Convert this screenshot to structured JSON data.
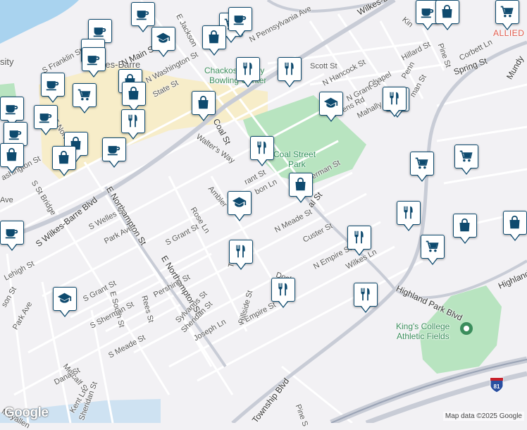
{
  "colors": {
    "background": "#f2f1f4",
    "road": "#ffffff",
    "major_road": "#c8ccd6",
    "river": "#a9d3ef",
    "park": "#b8e4c0",
    "downtown": "#f7edc9",
    "marker_border": "#0e4a6e",
    "marker_icon": "#0e4a6e"
  },
  "labels": {
    "wilkes_barre_city": "lkes-Barre",
    "university": "sity",
    "wilkes_st": "Wilkes-Ba",
    "allied": "ALLIED",
    "chackos": "Chackos Family",
    "bowling": "Bowling Center",
    "coal_street_park": "Coal Street",
    "coal_street_park_2": "Park",
    "kings_college": "King's College",
    "kings_college_2": "Athletic Fields",
    "n_main_st": "N Main St",
    "n_pennsylvania_ave": "N Pennsylvania Ave",
    "n_washington_st": "N Washington St",
    "s_franklin_st": "S Franklin St",
    "scott_st": "Scott St",
    "hillard_st": "Hillard St",
    "corbett_ln": "Corbett Ln",
    "spring_st": "Spring St",
    "mundy": "Mundy",
    "pine_st": "Pine St",
    "chapel": "Chapel",
    "n_hancock_st": "N Hancock St",
    "n_grant_st": "N Grant St",
    "mahally_st": "Mahally St",
    "stevens_rd": "Stevens Rd",
    "coal_st": "Coal St",
    "walters_way": "Walter's Way",
    "sherman_st": "erman St",
    "ambler": "Ambler",
    "grant_st": "rant St",
    "gibbon_ln": "bon Ln",
    "coal_st_2": "al St",
    "n_meade_st": "N Meade St",
    "custer_st": "Custer St",
    "n_empire_st": "N Empire St",
    "wilkes_ln": "Wilkes Ln",
    "dock": "Dock",
    "s_empire_st": "S Empire St",
    "highland_park_blvd": "Highland Park Blvd",
    "highland": "Highland",
    "s_wilkes_barre_blvd": "S Wilkes-Barre Blvd",
    "e_northampton_st": "E Northampton St",
    "e_northampton_st_2": "E Northampton St",
    "s_welles_st": "S Welles St",
    "park_ave": "Park Ave",
    "rose_ln": "Rose Ln",
    "s_grant_st": "S Grant St",
    "s_st_bridge": "S St Bridge",
    "ashington_st": "ashington St",
    "ave": "Ave",
    "lehigh_st": "Lehigh St",
    "son_st": "son St",
    "park_ave_2": "Park Ave",
    "s_grant_st_2": "S Grant St",
    "e_south_st": "E South St",
    "rees_st": "Rees St",
    "pershing_st": "Pershing St",
    "sylvanus_st": "Sylvanus St",
    "taft_st": "Taft St",
    "sheridan_st": "Sheridan St",
    "hillside_st": "Hillside St",
    "joseph_ln": "Joseph Ln",
    "s_sherman_st": "S Sherman St",
    "s_meade_st": "S Meade St",
    "metcalf_st": "Metcalf St",
    "dana_st": "Dana St",
    "kent_ln": "Kent Ln",
    "moyallen": "Moyallen",
    "sheridan_st_2": "Sheridan St",
    "township_blvd": "Township Blvd",
    "pine_st_2": "Pine S",
    "e_jackson": "E Jackson",
    "state_st": "State St",
    "northa": "E Northa",
    "kin": "Kin",
    "penn": "Penn",
    "man_st": "man St",
    "interstate": "81"
  },
  "markers": [
    {
      "type": "cafe-icon"
    },
    {
      "type": "cafe-icon"
    },
    {
      "type": "grocery-icon"
    },
    {
      "type": "cafe-icon"
    },
    {
      "type": "school-icon"
    },
    {
      "type": "cafe-icon"
    },
    {
      "type": "shopping-bag-icon"
    },
    {
      "type": "cafe-icon"
    },
    {
      "type": "shopping-bag-icon"
    },
    {
      "type": "grocery-icon"
    },
    {
      "type": "cafe-icon"
    },
    {
      "type": "grocery-icon"
    },
    {
      "type": "shopping-bag-icon"
    },
    {
      "type": "shopping-bag-icon"
    },
    {
      "type": "restaurant-icon"
    },
    {
      "type": "restaurant-icon"
    },
    {
      "type": "cafe-icon"
    },
    {
      "type": "cafe-icon"
    },
    {
      "type": "cafe-icon"
    },
    {
      "type": "cafe-icon"
    },
    {
      "type": "shopping-bag-icon"
    },
    {
      "type": "school-icon"
    },
    {
      "type": "shopping-bag-icon"
    },
    {
      "type": "shopping-bag-icon"
    },
    {
      "type": "cafe-icon"
    },
    {
      "type": "shopping-bag-icon"
    },
    {
      "type": "restaurant-icon"
    },
    {
      "type": "school-icon"
    },
    {
      "type": "restaurant-icon"
    },
    {
      "type": "restaurant-icon"
    },
    {
      "type": "grocery-icon"
    },
    {
      "type": "grocery-icon"
    },
    {
      "type": "school-icon"
    },
    {
      "type": "restaurant-icon"
    },
    {
      "type": "shopping-bag-icon"
    },
    {
      "type": "shopping-bag-icon"
    },
    {
      "type": "restaurant-icon"
    },
    {
      "type": "grocery-icon"
    },
    {
      "type": "school-icon"
    },
    {
      "type": "restaurant-icon"
    },
    {
      "type": "restaurant-icon"
    },
    {
      "type": "restaurant-icon"
    },
    {
      "type": "shopping-bag-icon"
    },
    {
      "type": "cafe-icon"
    }
  ],
  "attribution": "Map data ©2025 Google",
  "logo": "Google"
}
